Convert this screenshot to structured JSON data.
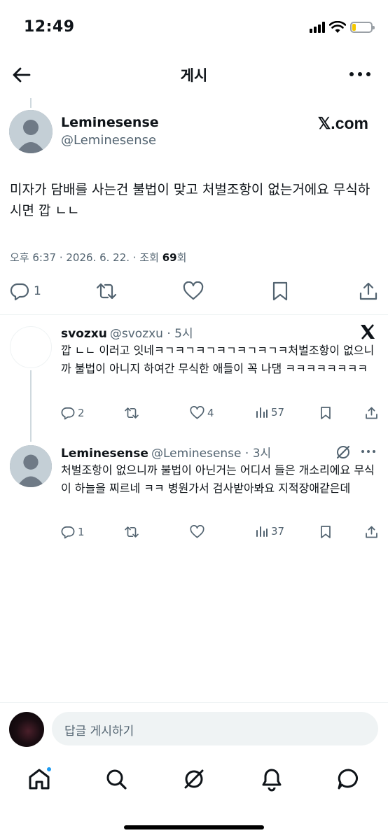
{
  "status_bar": {
    "time": "12:49",
    "battery_level": 0.2
  },
  "header": {
    "title": "게시",
    "back_icon": "arrow-left-icon",
    "more_icon": "more-dots-icon"
  },
  "main_post": {
    "display_name": "Leminesense",
    "handle": "@Leminesense",
    "watermark": "𝕏.com",
    "text": "미자가 담배를 사는건 불법이 맞고 처벌조항이 없는거에요 무식하시면 깝 ㄴㄴ",
    "meta_prefix": "오후 6:37 · 2026. 6. 22. · 조회 ",
    "views": "69",
    "meta_suffix": "회",
    "reply_count": "1"
  },
  "replies": [
    {
      "display_name": "svozxu",
      "handle": "@svozxu · 5시",
      "corner_icon": "x-logo-icon",
      "text": "깝 ㄴㄴ 이러고 잇네ㅋㄱㅋㄱㅋㄱㅋㄱㅋㄱㅋㄱㅋ처벌조항이 없으니까 불법이 아니지 하여간 무식한 애들이 꼭 나댐 ㅋㅋㅋㅋㅋㅋㅋㅋ",
      "replies": "2",
      "retweets": "",
      "likes": "4",
      "views": "57"
    },
    {
      "display_name": "Leminesense",
      "handle": "@Leminesense · 3시",
      "corner_icon": "grok-icon",
      "text": "처벌조항이 없으니까 불법이 아닌거는 어디서 들은 개소리에요 무식이 하늘을 찌르네 ㅋㅋ 병원가서 검사받아봐요 지적장애같은데",
      "replies": "1",
      "retweets": "",
      "likes": "",
      "views": "37"
    }
  ],
  "composer": {
    "placeholder": "답글 게시하기"
  },
  "bottom_nav": [
    "home-icon",
    "search-icon",
    "grok-icon",
    "notifications-icon",
    "messages-icon"
  ],
  "colors": {
    "accent": "#1d9bf0",
    "text": "#0f1419",
    "secondary": "#536471"
  }
}
